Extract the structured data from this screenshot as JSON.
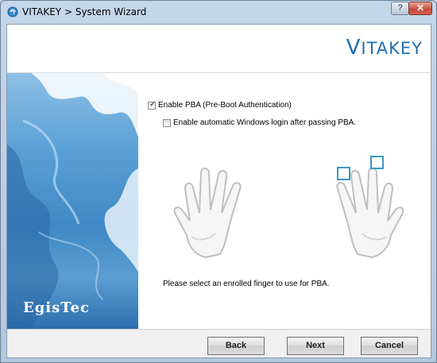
{
  "window": {
    "title": "VITAKEY > System Wizard",
    "help_label": "?",
    "close_label": "✕"
  },
  "header": {
    "logo_first": "V",
    "logo_rest": "ITAKEY"
  },
  "sidebar": {
    "brand": "EgisTec"
  },
  "options": {
    "enable_pba": {
      "label": "Enable PBA (Pre-Boot Authentication)",
      "checked": true
    },
    "auto_login": {
      "label": "Enable automatic Windows login after passing PBA.",
      "checked": false
    }
  },
  "hint": "Please select an enrolled finger to use for PBA.",
  "buttons": {
    "back": "Back",
    "next": "Next",
    "cancel": "Cancel"
  },
  "colors": {
    "accent": "#1f6fb0",
    "finger_box": "#3d98c4"
  }
}
